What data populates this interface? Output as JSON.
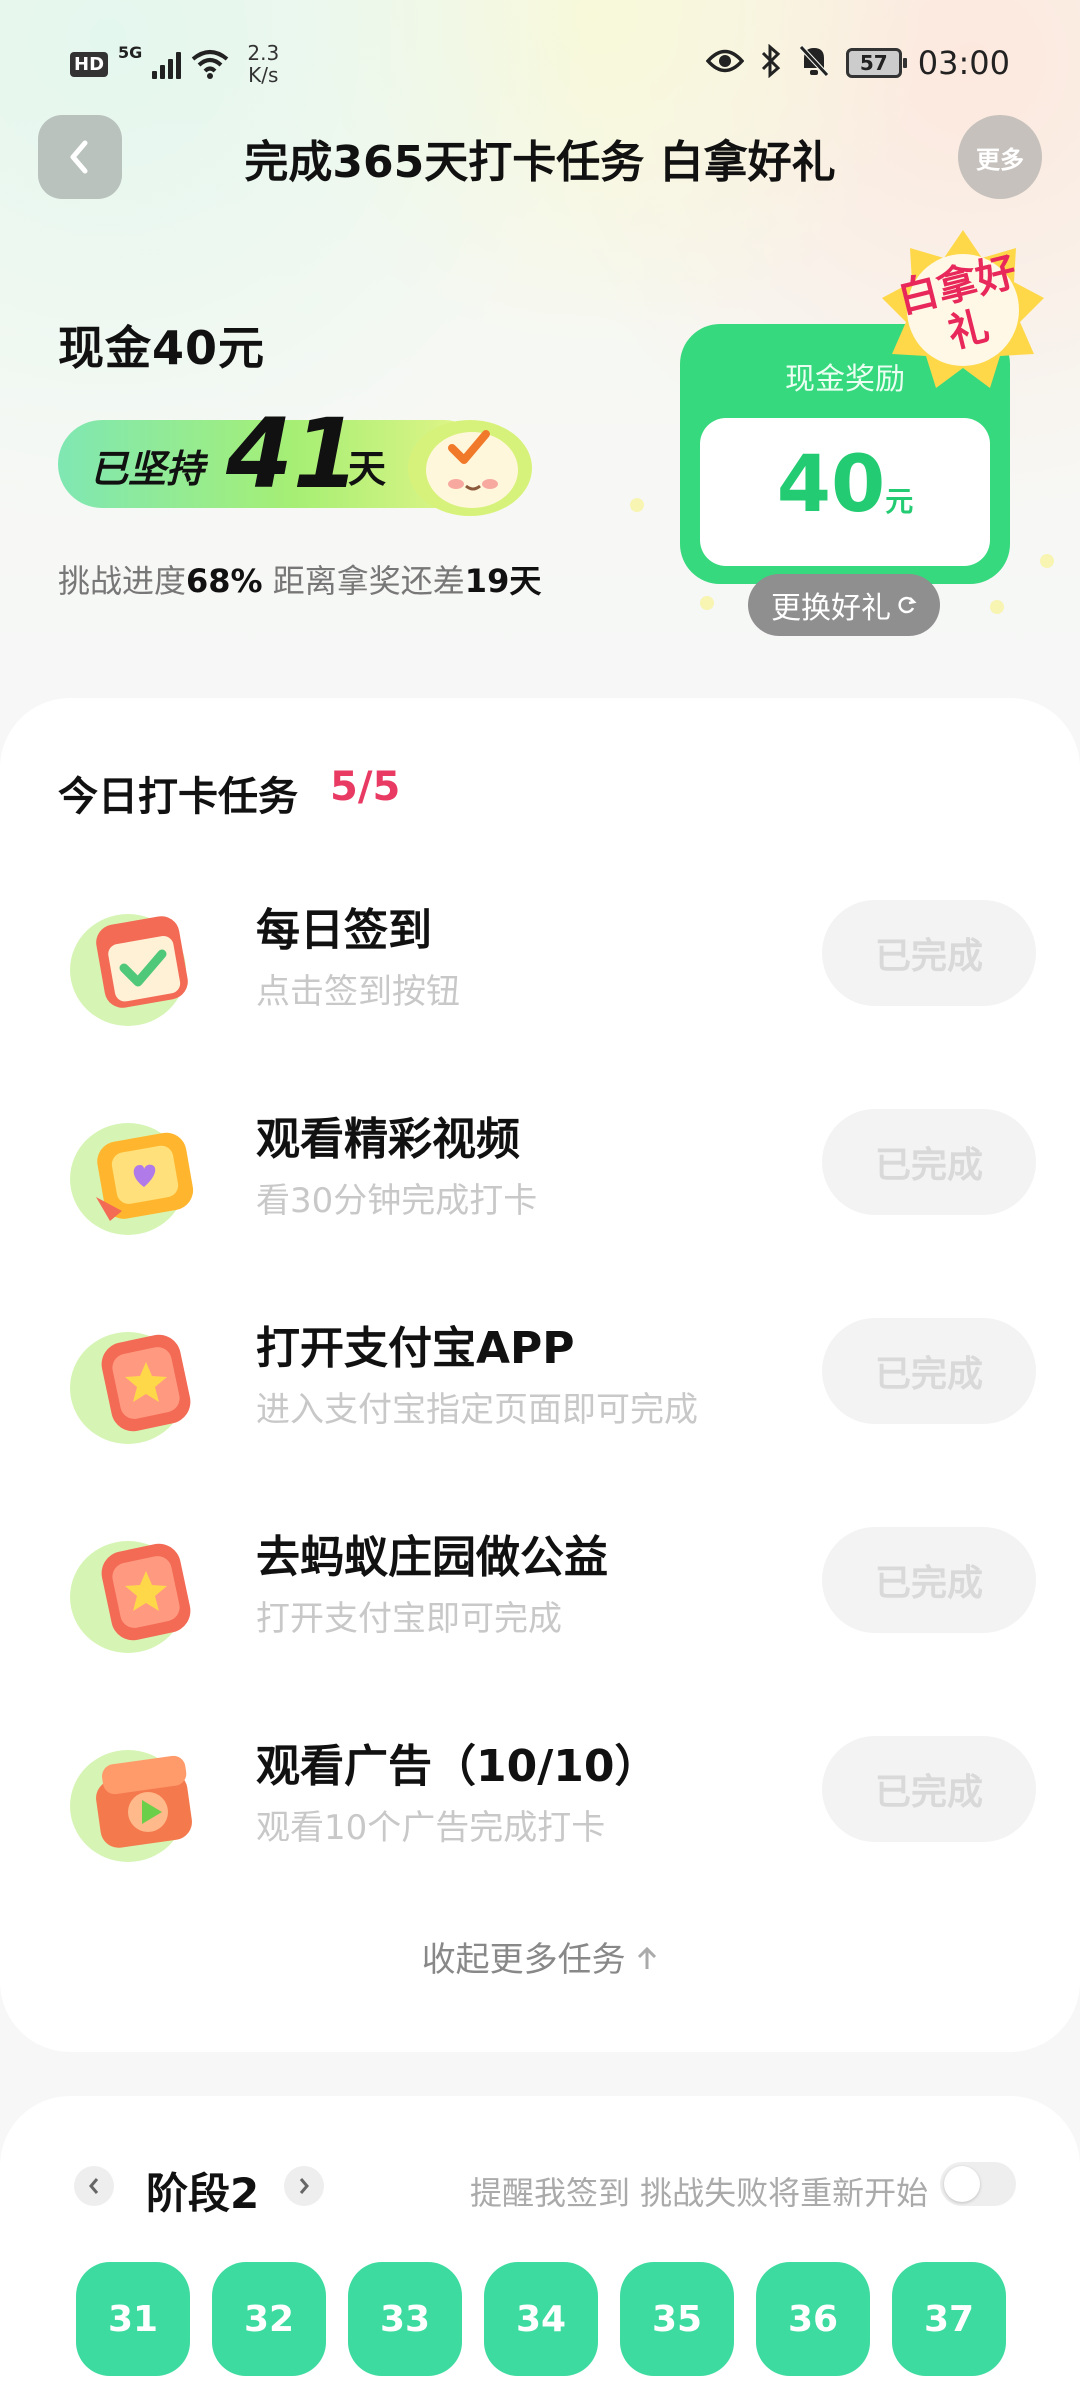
{
  "status_bar": {
    "hd": "HD",
    "network": "5G",
    "speed_value": "2.3",
    "speed_unit": "K/s",
    "battery": "57",
    "time": "03:00"
  },
  "header": {
    "title": "完成365天打卡任务 白拿好礼",
    "more_label": "更多"
  },
  "hero": {
    "cash_title": "现金40元",
    "streak_prefix": "已坚持",
    "streak_days": "41",
    "streak_suffix": "天",
    "progress_label": "挑战进度",
    "progress_value": "68%",
    "remaining_label": "距离拿奖还差",
    "remaining_value": "19天",
    "reward_label": "现金奖励",
    "reward_amount": "40",
    "reward_unit": "元",
    "gift_badge": "白拿好礼",
    "change_gift": "更换好礼"
  },
  "tasks": {
    "heading": "今日打卡任务",
    "count": "5/5",
    "items": [
      {
        "title": "每日签到",
        "subtitle": "点击签到按钮",
        "button": "已完成",
        "icon": "calendar-check-icon"
      },
      {
        "title": "观看精彩视频",
        "subtitle": "看30分钟完成打卡",
        "button": "已完成",
        "icon": "tv-heart-icon"
      },
      {
        "title": "打开支付宝APP",
        "subtitle": "进入支付宝指定页面即可完成",
        "button": "已完成",
        "icon": "app-star-icon"
      },
      {
        "title": "去蚂蚁庄园做公益",
        "subtitle": "打开支付宝即可完成",
        "button": "已完成",
        "icon": "app-star-icon"
      },
      {
        "title": "观看广告（10/10）",
        "subtitle": "观看10个广告完成打卡",
        "button": "已完成",
        "icon": "ad-play-icon"
      }
    ],
    "collapse_label": "收起更多任务"
  },
  "stage": {
    "title": "阶段2",
    "remind_text": "提醒我签到 挑战失败将重新开始",
    "reminder_on": false,
    "days": [
      "31",
      "32",
      "33",
      "34",
      "35",
      "36",
      "37"
    ]
  },
  "colors": {
    "accent_green": "#36d97d",
    "day_green": "#3ddba0",
    "count_red": "#e83a63"
  }
}
